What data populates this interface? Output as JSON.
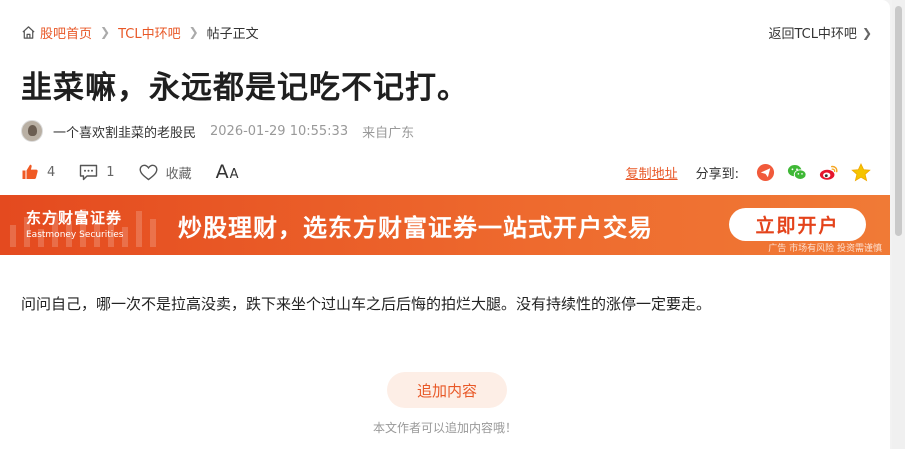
{
  "breadcrumb": {
    "home": "股吧首页",
    "forum": "TCL中环吧",
    "current": "帖子正文",
    "back": "返回TCL中环吧"
  },
  "post": {
    "title": "韭菜嘛，永远都是记吃不记打。",
    "author": "一个喜欢割韭菜的老股民",
    "time": "2026-01-29 10:55:33",
    "location": "来自广东",
    "body": "问问自己，哪一次不是拉高没卖，跌下来坐个过山车之后后悔的拍烂大腿。没有持续性的涨停一定要走。"
  },
  "actions": {
    "likes": "4",
    "comments": "1",
    "favorite": "收藏",
    "font_big": "A",
    "font_small": "A",
    "copy_link": "复制地址",
    "share_label": "分享到:"
  },
  "banner": {
    "brand_cn": "东方财富证券",
    "brand_en": "Eastmoney Securities",
    "slogan": "炒股理财，选东方财富证券一站式开户交易",
    "button": "立即开户",
    "ad_note": "广告 市场有风险 投资需谨慎"
  },
  "footer": {
    "append_button": "追加内容",
    "append_hint": "本文作者可以追加内容哦！"
  },
  "colors": {
    "accent": "#e85827",
    "banner": "#e44a1f"
  }
}
